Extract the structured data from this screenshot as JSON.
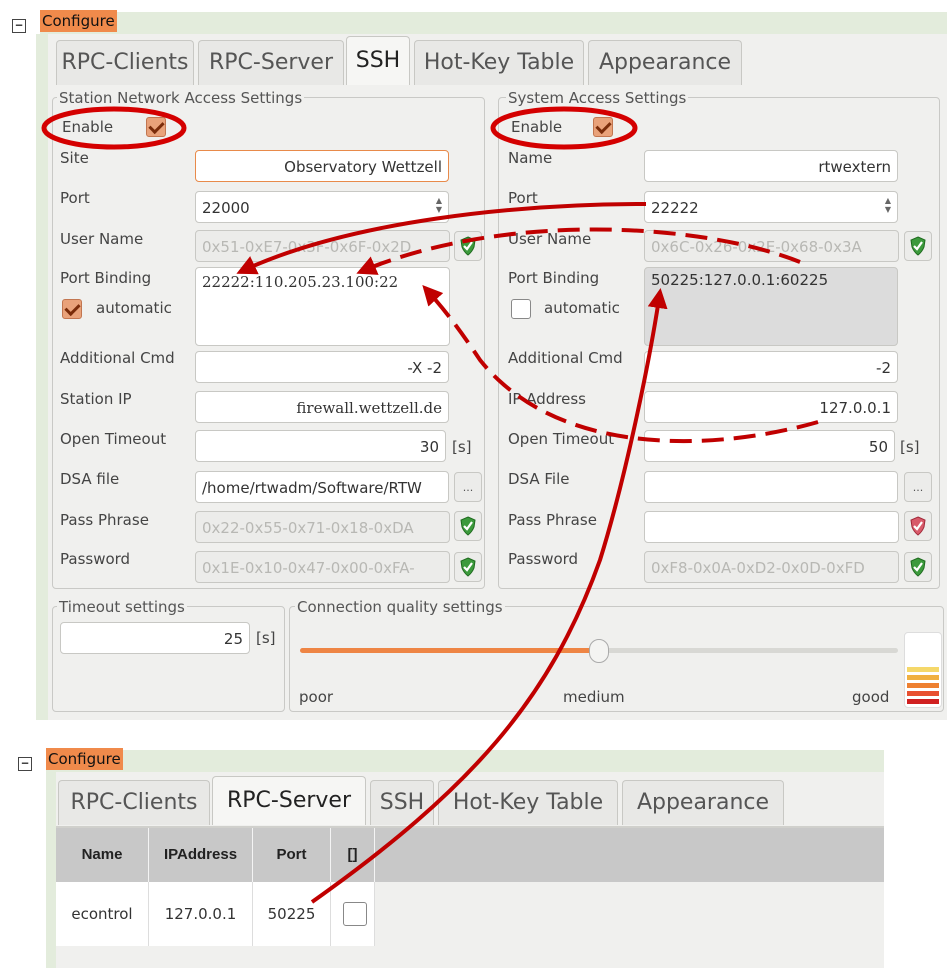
{
  "top": {
    "header": {
      "collapse": "−",
      "title": "Configure"
    },
    "tabs": [
      "RPC-Clients",
      "RPC-Server",
      "SSH",
      "Hot-Key Table",
      "Appearance"
    ],
    "active_tab": "SSH",
    "station": {
      "group_title": "Station Network Access Settings",
      "enable_label": "Enable",
      "enable_checked": true,
      "site_label": "Site",
      "site_value": "Observatory Wettzell",
      "port_label": "Port",
      "port_value": "22000",
      "user_label": "User Name",
      "user_value": "0x51-0xE7-0x3F-0x6F-0x2D",
      "binding_label": "Port Binding",
      "binding_value": "22222:110.205.23.100:22",
      "automatic_label": "automatic",
      "automatic_checked": true,
      "cmd_label": "Additional Cmd",
      "cmd_value": "-X -2",
      "ip_label": "Station IP",
      "ip_value": "firewall.wettzell.de",
      "timeout_label": "Open Timeout",
      "timeout_value": "30",
      "timeout_unit": "[s]",
      "dsa_label": "DSA file",
      "dsa_value": "/home/rtwadm/Software/RTW",
      "browse_label": "...",
      "pass_label": "Pass Phrase",
      "pass_value": "0x22-0x55-0x71-0x18-0xDA",
      "password_label": "Password",
      "password_value": "0x1E-0x10-0x47-0x00-0xFA-"
    },
    "system": {
      "group_title": "System Access Settings",
      "enable_label": "Enable",
      "enable_checked": true,
      "name_label": "Name",
      "name_value": "rtwextern",
      "port_label": "Port",
      "port_value": "22222",
      "user_label": "User Name",
      "user_value": "0x6C-0x26-0x2E-0x68-0x3A",
      "binding_label": "Port Binding",
      "binding_value": "50225:127.0.0.1:60225",
      "automatic_label": "automatic",
      "automatic_checked": false,
      "cmd_label": "Additional Cmd",
      "cmd_value": "-2",
      "ip_label": "IP Address",
      "ip_value": "127.0.0.1",
      "timeout_label": "Open Timeout",
      "timeout_value": "50",
      "timeout_unit": "[s]",
      "dsa_label": "DSA File",
      "dsa_value": "",
      "browse_label": "...",
      "pass_label": "Pass Phrase",
      "pass_value": "",
      "password_label": "Password",
      "password_value": "0xF8-0x0A-0xD2-0x0D-0xFD"
    },
    "timeout_group": {
      "title": "Timeout settings",
      "value": "25",
      "unit": "[s]"
    },
    "quality_group": {
      "title": "Connection quality settings",
      "left": "poor",
      "middle": "medium",
      "right": "good",
      "level": 0.5
    }
  },
  "bottom": {
    "header": {
      "collapse": "−",
      "title": "Configure"
    },
    "tabs": [
      "RPC-Clients",
      "RPC-Server",
      "SSH",
      "Hot-Key Table",
      "Appearance"
    ],
    "active_tab": "RPC-Server",
    "table": {
      "columns": [
        "Name",
        "IPAddress",
        "Port",
        "[]"
      ],
      "rows": [
        {
          "name": "econtrol",
          "ip": "127.0.0.1",
          "port": "50225",
          "checked": false
        }
      ]
    }
  },
  "colors": {
    "accent_orange": "#f08a4b",
    "annotation_red": "#c00000",
    "ok_green": "#3c9a3c",
    "error_red": "#c83c3c"
  },
  "icons": {
    "check_ok": "shield-check-icon",
    "check_error": "shield-error-icon",
    "spin": "spin-arrows-icon"
  }
}
